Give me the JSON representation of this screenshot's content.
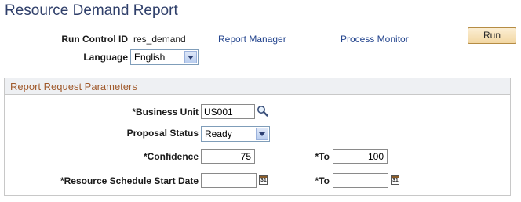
{
  "page": {
    "title": "Resource Demand Report"
  },
  "header": {
    "run_control_label": "Run Control ID",
    "run_control_value": "res_demand",
    "report_manager": "Report Manager",
    "process_monitor": "Process Monitor",
    "run_label": "Run",
    "language_label": "Language",
    "language_value": "English"
  },
  "params": {
    "title": "Report Request Parameters",
    "business_unit_label": "*Business Unit",
    "business_unit_value": "US001",
    "proposal_status_label": "Proposal Status",
    "proposal_status_value": "Ready",
    "confidence_label": "*Confidence",
    "confidence_from": "75",
    "confidence_to_label": "*To",
    "confidence_to": "100",
    "start_date_label": "*Resource Schedule Start Date",
    "start_date_from": "",
    "start_date_to_label": "*To",
    "start_date_to": ""
  },
  "icons": {
    "lookup": "magnifier-icon",
    "calendar": "calendar-icon"
  }
}
